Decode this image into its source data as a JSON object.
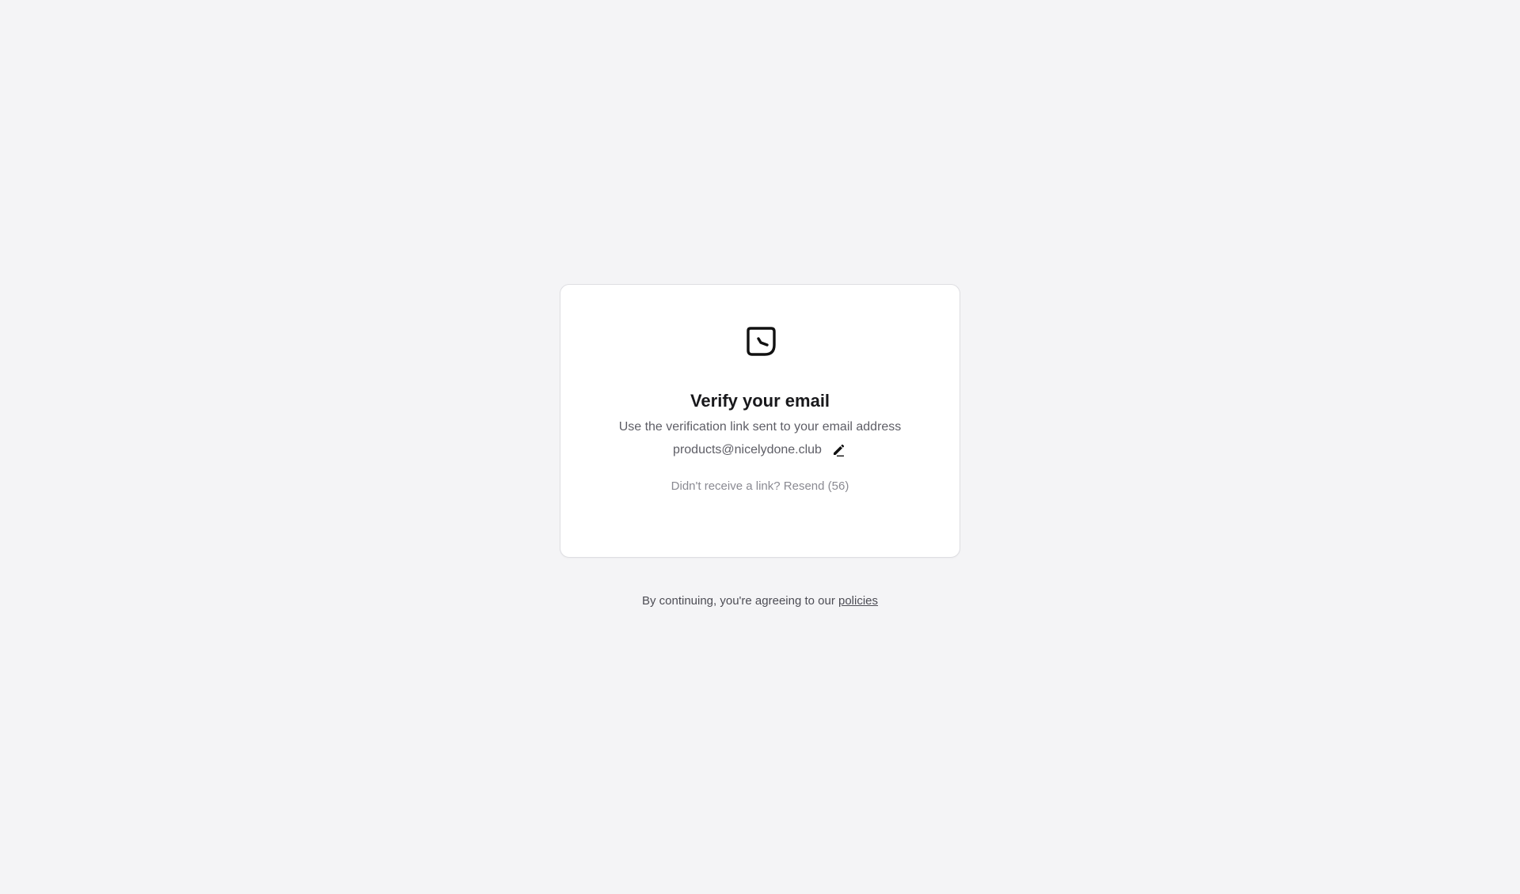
{
  "card": {
    "logo_icon": "logo-icon",
    "title": "Verify your email",
    "subtitle": "Use the verification link sent to your email address",
    "email": "products@nicelydone.club",
    "edit_icon": "pencil-icon",
    "resend_prompt": "Didn't receive a link?",
    "resend_label": "Resend (56)"
  },
  "footer": {
    "text": "By continuing, you're agreeing to our",
    "link_label": "policies"
  },
  "colors": {
    "background": "#f4f4f6",
    "card": "#ffffff",
    "title": "#18181b",
    "muted": "#5e5e66"
  }
}
